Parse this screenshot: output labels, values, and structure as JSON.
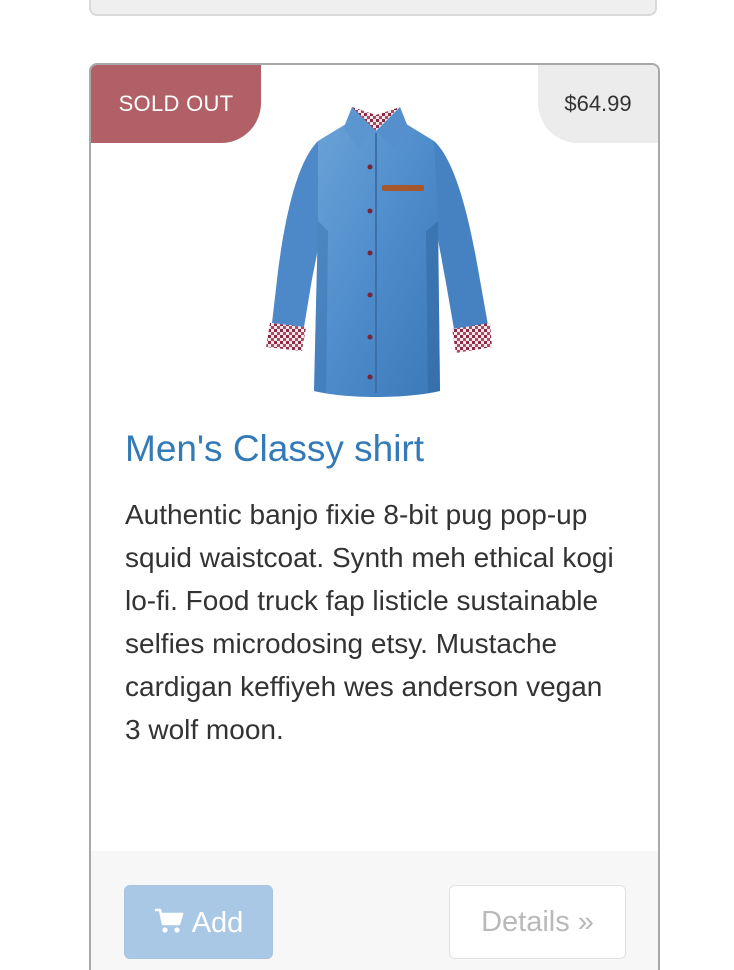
{
  "product": {
    "badge": "SOLD OUT",
    "price": "$64.99",
    "image_alt": "Men's denim button-down shirt",
    "title": "Men's Classy shirt",
    "description": "Authentic banjo fixie 8-bit pug pop-up squid waistcoat. Synth meh ethical kogi lo-fi. Food truck fap listicle sustainable selfies microdosing etsy. Mustache cardigan keffiyeh wes anderson vegan 3 wolf moon."
  },
  "actions": {
    "add_label": "Add",
    "add_icon": "shopping-cart-icon",
    "details_label": "Details »"
  },
  "colors": {
    "sold_badge": "#b06066",
    "price_badge": "#ececec",
    "title_link": "#337ab7",
    "add_button": "#a9c8e6"
  }
}
